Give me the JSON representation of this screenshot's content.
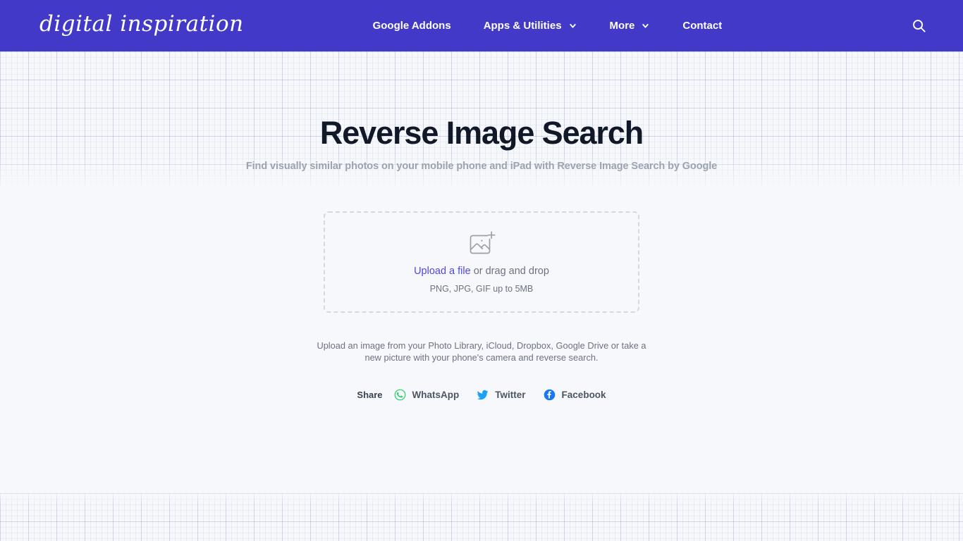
{
  "header": {
    "logo_text": "digital inspiration",
    "background_color": "#4339c8",
    "nav": [
      {
        "label": "Google Addons",
        "has_dropdown": false,
        "icon": ""
      },
      {
        "label": "Apps & Utilities",
        "has_dropdown": true,
        "icon": "chevron-down-icon"
      },
      {
        "label": "More",
        "has_dropdown": true,
        "icon": "chevron-down-icon"
      },
      {
        "label": "Contact",
        "has_dropdown": false,
        "icon": ""
      }
    ],
    "search_icon": "search-icon"
  },
  "main": {
    "title": "Reverse Image Search",
    "subtitle": "Find visually similar photos on your mobile phone and iPad with Reverse Image Search by Google",
    "dropzone": {
      "icon": "image-plus-icon",
      "link_label": "Upload a file",
      "rest_label": " or drag and drop",
      "hint": "PNG, JPG, GIF up to 5MB",
      "link_color": "#4f46e5",
      "border_color": "#d5d8de"
    },
    "help_text": "Upload an image from your Photo Library, iCloud, Dropbox, Google Drive or take a new picture with your phone's camera and reverse search.",
    "share": {
      "label": "Share",
      "items": [
        {
          "label": "WhatsApp",
          "icon": "whatsapp-icon",
          "color": "#25D366"
        },
        {
          "label": "Twitter",
          "icon": "twitter-icon",
          "color": "#1da1f2"
        },
        {
          "label": "Facebook",
          "icon": "facebook-icon",
          "color": "#1877f2"
        }
      ]
    }
  },
  "theme": {
    "page_background": "#f7f8fb",
    "grid_line_color": "#6373be",
    "title_color": "#111827",
    "muted_text_color": "#6b7280"
  }
}
